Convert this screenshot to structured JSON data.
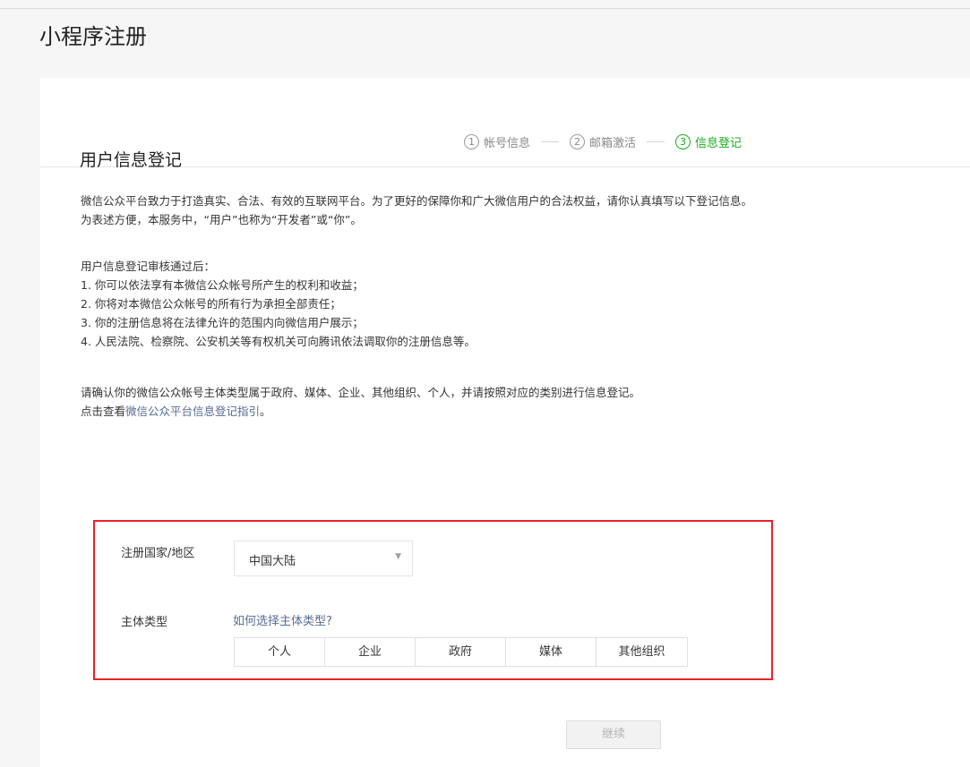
{
  "page": {
    "title": "小程序注册"
  },
  "steps": [
    {
      "num": "1",
      "label": "帐号信息",
      "active": false
    },
    {
      "num": "2",
      "label": "邮箱激活",
      "active": false
    },
    {
      "num": "3",
      "label": "信息登记",
      "active": true
    }
  ],
  "section": {
    "title": "用户信息登记",
    "intro": [
      "微信公众平台致力于打造真实、合法、有效的互联网平台。为了更好的保障你和广大微信用户的合法权益，请你认真填写以下登记信息。",
      "为表述方便，本服务中，“用户”也称为“开发者”或“你”。"
    ],
    "rights": [
      "用户信息登记审核通过后：",
      "1. 你可以依法享有本微信公众帐号所产生的权利和收益；",
      "2. 你将对本微信公众帐号的所有行为承担全部责任；",
      "3. 你的注册信息将在法律允许的范围内向微信用户展示；",
      "4. 人民法院、检察院、公安机关等有权机关可向腾讯依法调取你的注册信息等。"
    ],
    "confirm_line": "请确认你的微信公众帐号主体类型属于政府、媒体、企业、其他组织、个人，并请按照对应的类别进行信息登记。",
    "guide_prefix": "点击查看",
    "guide_link": "微信公众平台信息登记指引",
    "guide_suffix": "。"
  },
  "form": {
    "country_label": "注册国家/地区",
    "country_value": "中国大陆",
    "country_caret": "▼",
    "type_label": "主体类型",
    "type_help_link": "如何选择主体类型?",
    "type_options": [
      "个人",
      "企业",
      "政府",
      "媒体",
      "其他组织"
    ]
  },
  "actions": {
    "continue_label": "继续"
  },
  "colors": {
    "accent_green": "#1aad19",
    "link_blue": "#576b95",
    "highlight_red": "#e5242a"
  }
}
